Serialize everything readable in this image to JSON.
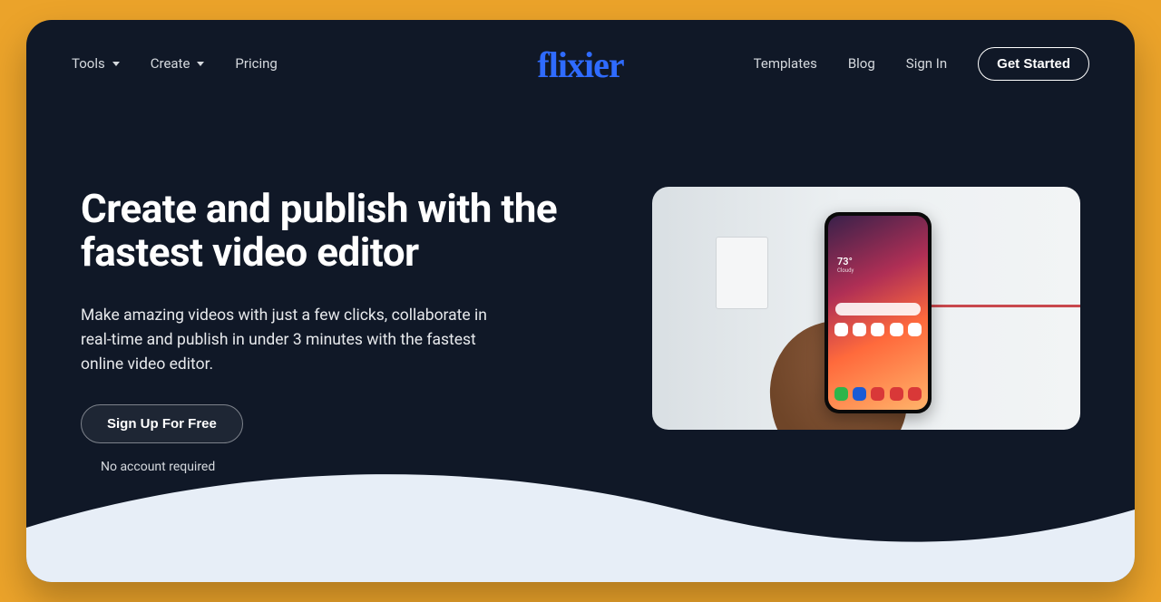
{
  "nav": {
    "left": {
      "tools": "Tools",
      "create": "Create",
      "pricing": "Pricing"
    },
    "logo": "flixier",
    "right": {
      "templates": "Templates",
      "blog": "Blog",
      "signin": "Sign In",
      "get_started": "Get Started"
    }
  },
  "hero": {
    "headline": "Create and publish with the fastest video editor",
    "sub": "Make amazing videos with just a few clicks, collaborate in real-time and publish in under 3 minutes with the fastest online video editor.",
    "cta": "Sign Up For Free",
    "subnote": "No account required"
  },
  "thumb": {
    "temp": "73°",
    "temp_sub": "Cloudy"
  }
}
